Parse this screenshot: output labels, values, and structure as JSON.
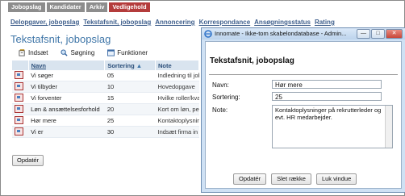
{
  "top_tabs": [
    "Jobopslag",
    "Kandidater",
    "Arkiv",
    "Vedligehold"
  ],
  "sub_links": [
    "Delopgaver, jobopslag",
    "Tekstafsnit, jobopslag",
    "Annoncering",
    "Korrespondance",
    "Ansøgningsstatus",
    "Rating"
  ],
  "page_title": "Tekstafsnit, jobopslag",
  "toolbar": {
    "insert": "Indsæt",
    "search": "Søgning",
    "functions": "Funktioner"
  },
  "table": {
    "headers": {
      "name": "Navn",
      "sort": "Sortering",
      "note": "Note"
    },
    "rows": [
      {
        "name": "Vi søger",
        "sort": "05",
        "note": "Indledning til job"
      },
      {
        "name": "Vi tilbyder",
        "sort": "10",
        "note": "Hovedopgave"
      },
      {
        "name": "Vi forventer",
        "sort": "15",
        "note": "Hvilke roller/kva"
      },
      {
        "name": "Løn & ansættelsesforhold",
        "sort": "20",
        "note": "Kort om løn, pe"
      },
      {
        "name": "Hør mere",
        "sort": "25",
        "note": "Kontaktoplysnin"
      },
      {
        "name": "Vi er",
        "sort": "30",
        "note": "Indsæt firma in"
      }
    ]
  },
  "save_button": "Opdatér",
  "dialog": {
    "window_title": "Innomate - Ikke-tom skabelondatabase - Admin...",
    "heading": "Tekstafsnit, jobopslag",
    "name_label": "Navn:",
    "name_value": "Hør mere",
    "sort_label": "Sortering:",
    "sort_value": "25",
    "note_label": "Note:",
    "note_value": "Kontaktoplysninger på rekrutterleder og evt. HR medarbejder.",
    "buttons": {
      "update": "Opdatér",
      "delete": "Slet række",
      "close": "Luk vindue"
    }
  }
}
